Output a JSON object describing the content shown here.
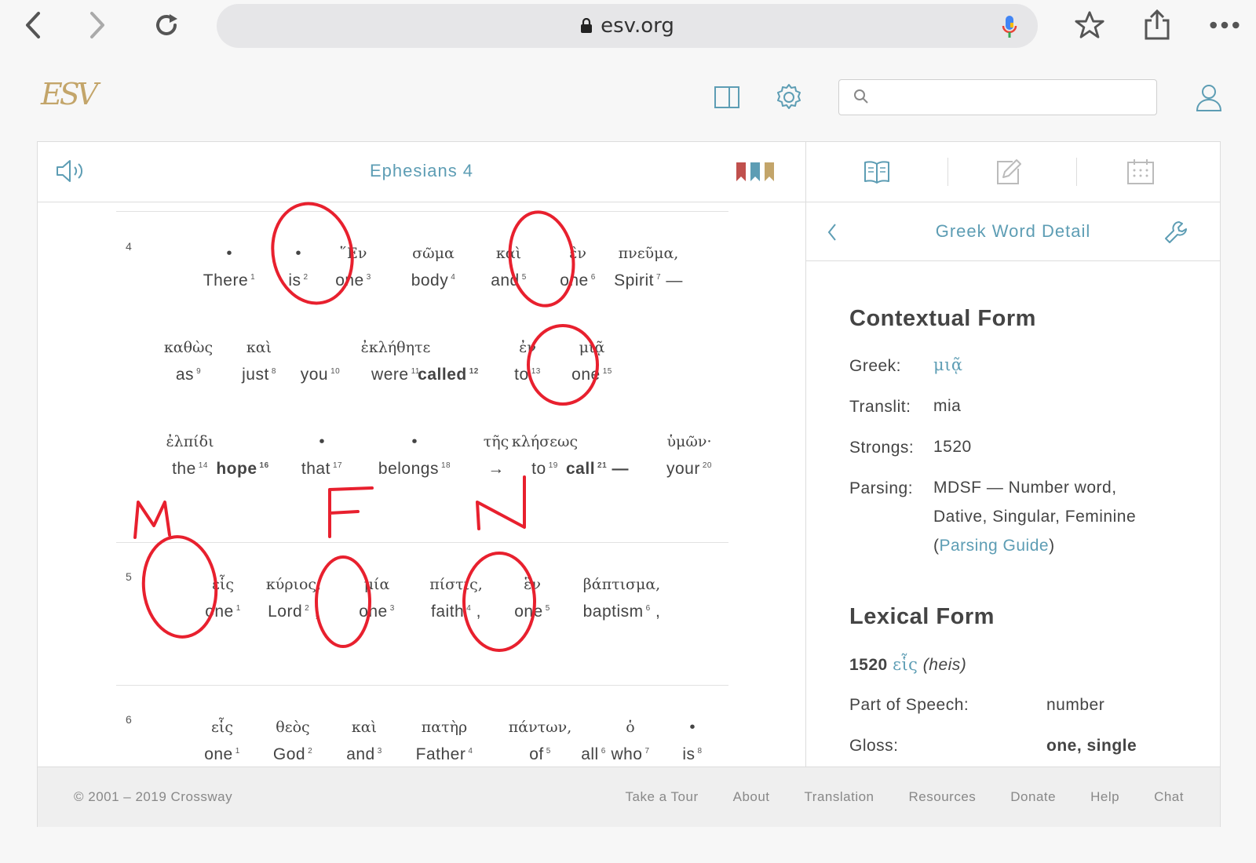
{
  "browser": {
    "url": "esv.org"
  },
  "search": {
    "placeholder": ""
  },
  "reader": {
    "title": "Ephesians 4",
    "ribbon_colors": [
      "#c0504d",
      "#5d9db4",
      "#c3a56a"
    ],
    "verse_4": {
      "number": "4"
    },
    "verse_5": {
      "number": "5"
    },
    "verse_6": {
      "number": "6"
    },
    "words": [
      {
        "g": "•",
        "e": "There",
        "n": "1"
      },
      {
        "g": "•",
        "e": "is",
        "n": "2"
      },
      {
        "g": "῞Εν",
        "e": "one",
        "n": "3"
      },
      {
        "g": "σῶμα",
        "e": "body",
        "n": "4"
      },
      {
        "g": "καὶ",
        "e": "and",
        "n": "5"
      },
      {
        "g": "ἓν",
        "e": "one",
        "n": "6"
      },
      {
        "g": "πνεῦμα,",
        "e": "Spirit",
        "n": "7",
        "after": " —"
      },
      {
        "g": "καθὼς",
        "e": "as",
        "n": "9"
      },
      {
        "g": "καὶ",
        "e": "just",
        "n": "8"
      },
      {
        "g": "",
        "e": "you",
        "n": "10"
      },
      {
        "g": "ἐκλήθητε",
        "e": "were",
        "n": "11"
      },
      {
        "g": "",
        "e": "called",
        "n": "12"
      },
      {
        "g": "ἐν",
        "e": "to",
        "n": "13"
      },
      {
        "g": "μιᾷ",
        "e": "one",
        "n": "15"
      },
      {
        "g": "ἐλπίδι",
        "e": "the",
        "n": "14"
      },
      {
        "g": "",
        "e": "hope",
        "n": "16"
      },
      {
        "g": "•",
        "e": "that",
        "n": "17"
      },
      {
        "g": "•",
        "e": "belongs",
        "n": "18"
      },
      {
        "g": "τῆς",
        "e": "→",
        "n": ""
      },
      {
        "g": "κλήσεως",
        "e": "to",
        "n": "19"
      },
      {
        "g": "",
        "e": "call",
        "n": "21",
        "after": " —"
      },
      {
        "g": "ὑμῶν·",
        "e": "your",
        "n": "20"
      },
      {
        "g": "εἷς",
        "e": "one",
        "n": "1"
      },
      {
        "g": "κύριος,",
        "e": "Lord",
        "n": "2",
        "after": " ,"
      },
      {
        "g": "μία",
        "e": "one",
        "n": "3"
      },
      {
        "g": "πίστις,",
        "e": "faith",
        "n": "4",
        "after": " ,"
      },
      {
        "g": "ἓν",
        "e": "one",
        "n": "5"
      },
      {
        "g": "βάπτισμα,",
        "e": "baptism",
        "n": "6",
        "after": " ,"
      },
      {
        "g": "εἷς",
        "e": "one",
        "n": "1"
      },
      {
        "g": "θεὸς",
        "e": "God",
        "n": "2"
      },
      {
        "g": "καὶ",
        "e": "and",
        "n": "3"
      },
      {
        "g": "πατὴρ",
        "e": "Father",
        "n": "4"
      },
      {
        "g": "πάντων,",
        "e": "of",
        "n": "5"
      },
      {
        "g": "",
        "e": "all",
        "n": "6"
      },
      {
        "g": "ὁ",
        "e": "who",
        "n": "7"
      },
      {
        "g": "•",
        "e": "is",
        "n": "8"
      }
    ]
  },
  "side": {
    "title": "Greek Word Detail",
    "contextual": {
      "heading": "Contextual Form",
      "greek_label": "Greek:",
      "greek_value": "μιᾷ",
      "translit_label": "Translit:",
      "translit_value": "mia",
      "strongs_label": "Strongs:",
      "strongs_value": "1520",
      "parsing_label": "Parsing:",
      "parsing_line1": "MDSF — Number word,",
      "parsing_line2": "Dative, Singular, Feminine",
      "parsing_open": "(",
      "parsing_link": "Parsing Guide",
      "parsing_close": ")"
    },
    "lexical": {
      "heading": "Lexical Form",
      "number": "1520",
      "greek": "εἷς",
      "translit": "(heis)",
      "pos_label": "Part of Speech:",
      "pos_value": "number",
      "gloss_label": "Gloss:",
      "gloss_value": "one, single"
    }
  },
  "footer": {
    "copyright": "© 2001 – 2019 Crossway",
    "links": [
      "Take a Tour",
      "About",
      "Translation",
      "Resources",
      "Donate",
      "Help",
      "Chat"
    ]
  },
  "annotation": {
    "color": "#e8202e",
    "letters": [
      "M",
      "F",
      "N"
    ]
  }
}
